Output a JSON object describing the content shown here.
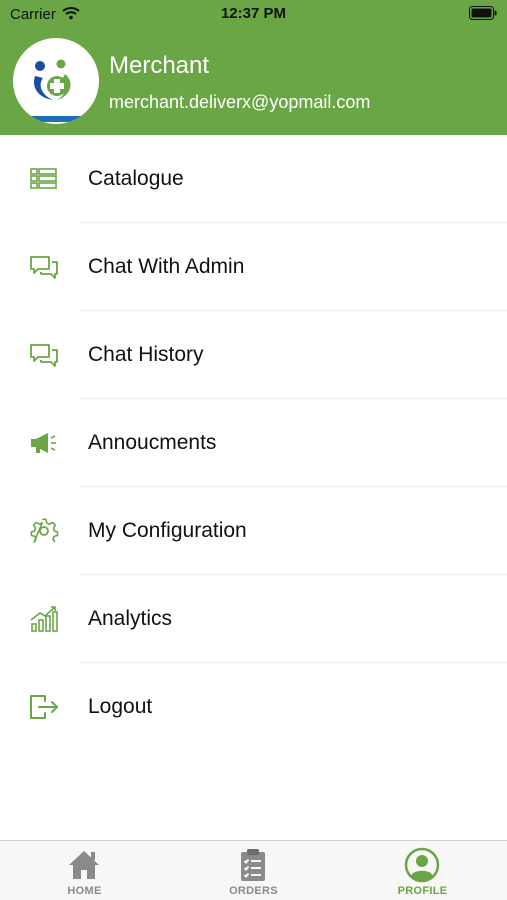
{
  "status_bar": {
    "carrier": "Carrier",
    "time": "12:37 PM"
  },
  "profile": {
    "name": "Merchant",
    "email": "merchant.deliverx@yopmail.com"
  },
  "colors": {
    "accent": "#6aa645",
    "inactive": "#8a8a8a"
  },
  "menu": [
    {
      "label": "Catalogue",
      "icon": "list-icon"
    },
    {
      "label": "Chat With Admin",
      "icon": "chat-icon"
    },
    {
      "label": "Chat History",
      "icon": "chat-icon"
    },
    {
      "label": "Annoucments",
      "icon": "megaphone-icon"
    },
    {
      "label": "My Configuration",
      "icon": "gear-icon"
    },
    {
      "label": "Analytics",
      "icon": "analytics-icon"
    },
    {
      "label": "Logout",
      "icon": "logout-icon"
    }
  ],
  "tabs": [
    {
      "label": "HOME",
      "icon": "home-icon",
      "active": false
    },
    {
      "label": "ORDERS",
      "icon": "clipboard-icon",
      "active": false
    },
    {
      "label": "PROFILE",
      "icon": "profile-icon",
      "active": true
    }
  ]
}
